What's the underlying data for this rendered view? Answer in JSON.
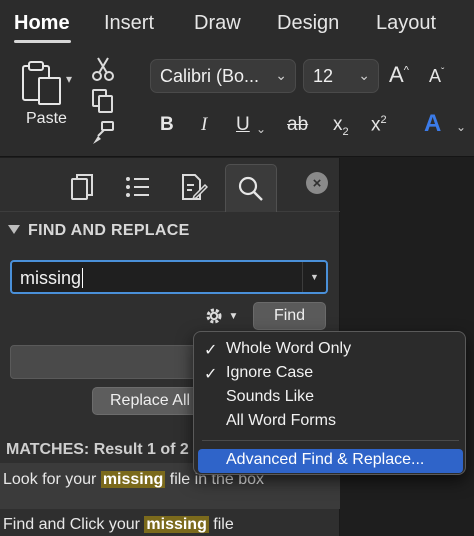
{
  "ribbon": {
    "tabs": [
      "Home",
      "Insert",
      "Draw",
      "Design",
      "Layout"
    ],
    "active_tab": "Home",
    "paste_label": "Paste",
    "font_name": "Calibri (Bo...",
    "font_size": "12",
    "grow_font": "A",
    "shrink_font": "A",
    "bold": "B",
    "italic": "I",
    "underline": "U",
    "strikethrough": "ab",
    "subscript": "x",
    "subscript_sub": "2",
    "superscript": "x",
    "superscript_sup": "2",
    "text_effects": "A"
  },
  "pane": {
    "section_title": "FIND AND REPLACE",
    "search_value": "missing",
    "find_button": "Find",
    "replace_all_button": "Replace All",
    "matches_header": "MATCHES: Result 1 of 2",
    "results": [
      {
        "before": "Look for your ",
        "match": "missing",
        "after": " file in the box"
      },
      {
        "before": "Find and Click your ",
        "match": "missing",
        "after": " file"
      }
    ]
  },
  "menu": {
    "items": [
      {
        "label": "Whole Word Only",
        "checked": true
      },
      {
        "label": "Ignore Case",
        "checked": true
      },
      {
        "label": "Sounds Like",
        "checked": false
      },
      {
        "label": "All Word Forms",
        "checked": false
      }
    ],
    "advanced": "Advanced Find & Replace...",
    "check_glyph": "✓"
  },
  "colors": {
    "accent_blue": "#2f64c9",
    "focus_border": "#4a90d9",
    "highlight": "#7b6a1c",
    "text_effects_blue": "#3b7be8"
  }
}
